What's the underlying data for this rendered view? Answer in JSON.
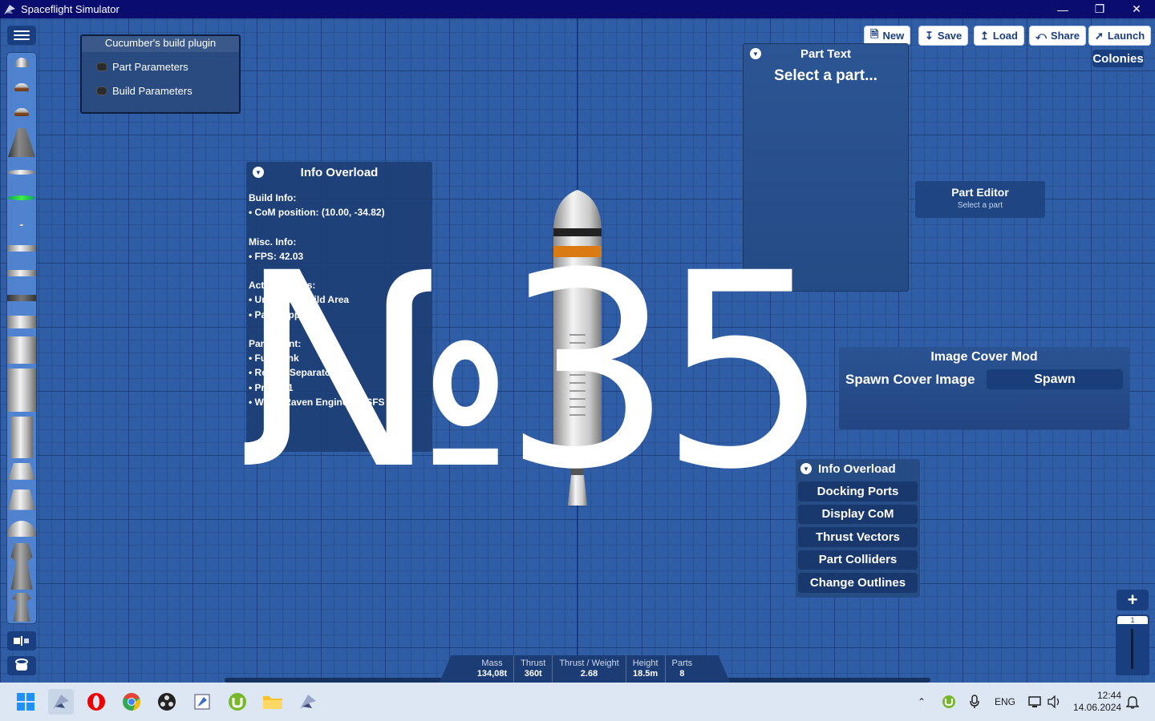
{
  "window": {
    "title": "Spaceflight Simulator"
  },
  "plugin_panel": {
    "title": "Cucumber's build plugin",
    "items": [
      "Part Parameters",
      "Build Parameters"
    ]
  },
  "toolbar": {
    "new": "New",
    "save": "Save",
    "load": "Load",
    "share": "Share",
    "launch": "Launch",
    "colonies": "Colonies"
  },
  "part_text": {
    "title": "Part Text",
    "placeholder": "Select a part..."
  },
  "part_editor": {
    "title": "Part Editor",
    "subtitle": "Select a part"
  },
  "info_overload": {
    "title": "Info Overload",
    "lines": [
      "Build Info:",
      "•  CoM position: (10.00, -34.82)",
      "",
      "Misc. Info:",
      "•  FPS: 42.03",
      "",
      "Active Cheats:",
      "•  Unlimited Build Area",
      "•  Part Clipping",
      "",
      "Part Count:",
      "•  Fuel Tank",
      "•  Recent Separator: 2",
      "•  Probe: 1",
      "•  White-Raven Engine for SFS V: 1"
    ]
  },
  "image_cover": {
    "title": "Image Cover Mod",
    "label": "Spawn Cover Image",
    "button": "Spawn"
  },
  "info_overload_menu": {
    "title": "Info Overload",
    "buttons": [
      "Docking Ports",
      "Display CoM",
      "Thrust Vectors",
      "Part Colliders",
      "Change Outlines"
    ]
  },
  "zoom": {
    "plus": "+",
    "level": "1"
  },
  "stats": [
    {
      "label": "Mass",
      "value": "134,08t"
    },
    {
      "label": "Thrust",
      "value": "360t"
    },
    {
      "label": "Thrust / Weight",
      "value": "2.68"
    },
    {
      "label": "Height",
      "value": "18.5m"
    },
    {
      "label": "Parts",
      "value": "8"
    }
  ],
  "overlay_text": "№35",
  "taskbar": {
    "language": "ENG",
    "time": "12:44",
    "date": "14.06.2024"
  },
  "colors": {
    "accent": "#1a3f80",
    "title_bar": "#0a0d6e",
    "grid_bg": "#2f5ea6"
  }
}
